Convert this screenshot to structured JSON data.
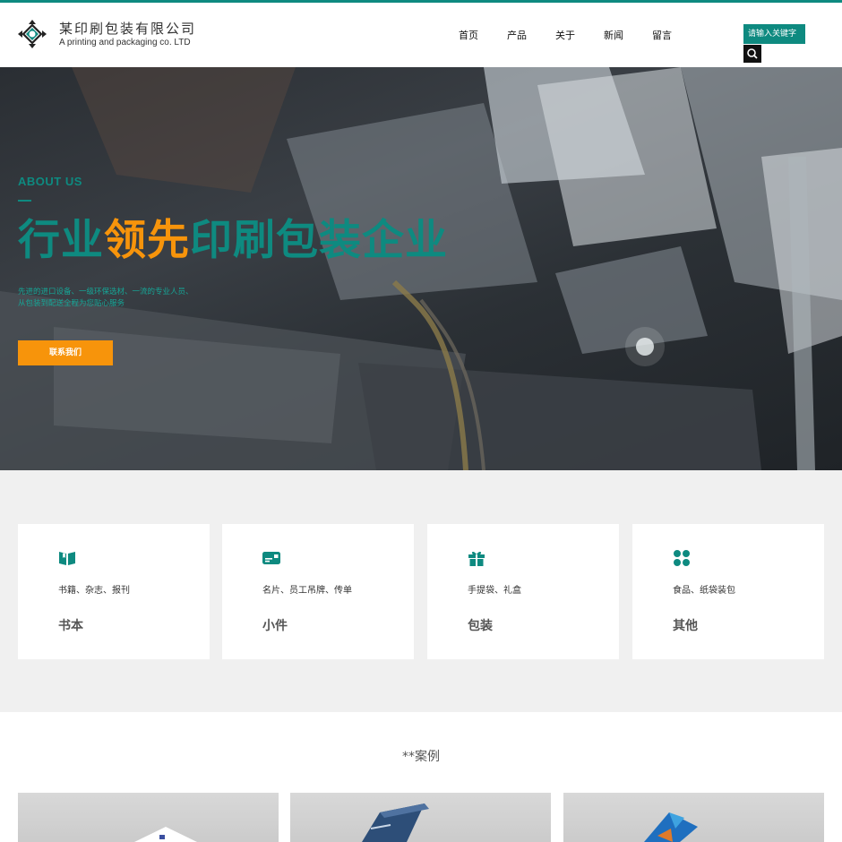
{
  "brand": {
    "name": "某印刷包装有限公司",
    "subtitle": "A printing and packaging co. LTD"
  },
  "nav": [
    {
      "label": "首页"
    },
    {
      "label": "产品"
    },
    {
      "label": "关于"
    },
    {
      "label": "新闻"
    },
    {
      "label": "留言"
    }
  ],
  "search": {
    "placeholder": "请输入关键字",
    "icon": "search-icon"
  },
  "hero": {
    "eyebrow": "ABOUT US",
    "title_part1": "行业",
    "title_part2": "领先",
    "title_part3": "印刷包装企业",
    "desc_line1": "先进的进口设备、一级环保选材、一流的专业人员、",
    "desc_line2": "从包装到配送全程为您贴心服务",
    "button": "联系我们"
  },
  "services": [
    {
      "icon": "book-icon",
      "desc": "书籍、杂志、报刊",
      "title": "书本"
    },
    {
      "icon": "card-icon",
      "desc": "名片、员工吊牌、传单",
      "title": "小件"
    },
    {
      "icon": "gift-icon",
      "desc": "手提袋、礼盒",
      "title": "包装"
    },
    {
      "icon": "grid-icon",
      "desc": "食品、纸袋装包",
      "title": "其他"
    }
  ],
  "cases": {
    "title": "**案例"
  },
  "colors": {
    "accent": "#0e8a80",
    "orange": "#f7940b",
    "gray_bg": "#f0f0f0"
  }
}
